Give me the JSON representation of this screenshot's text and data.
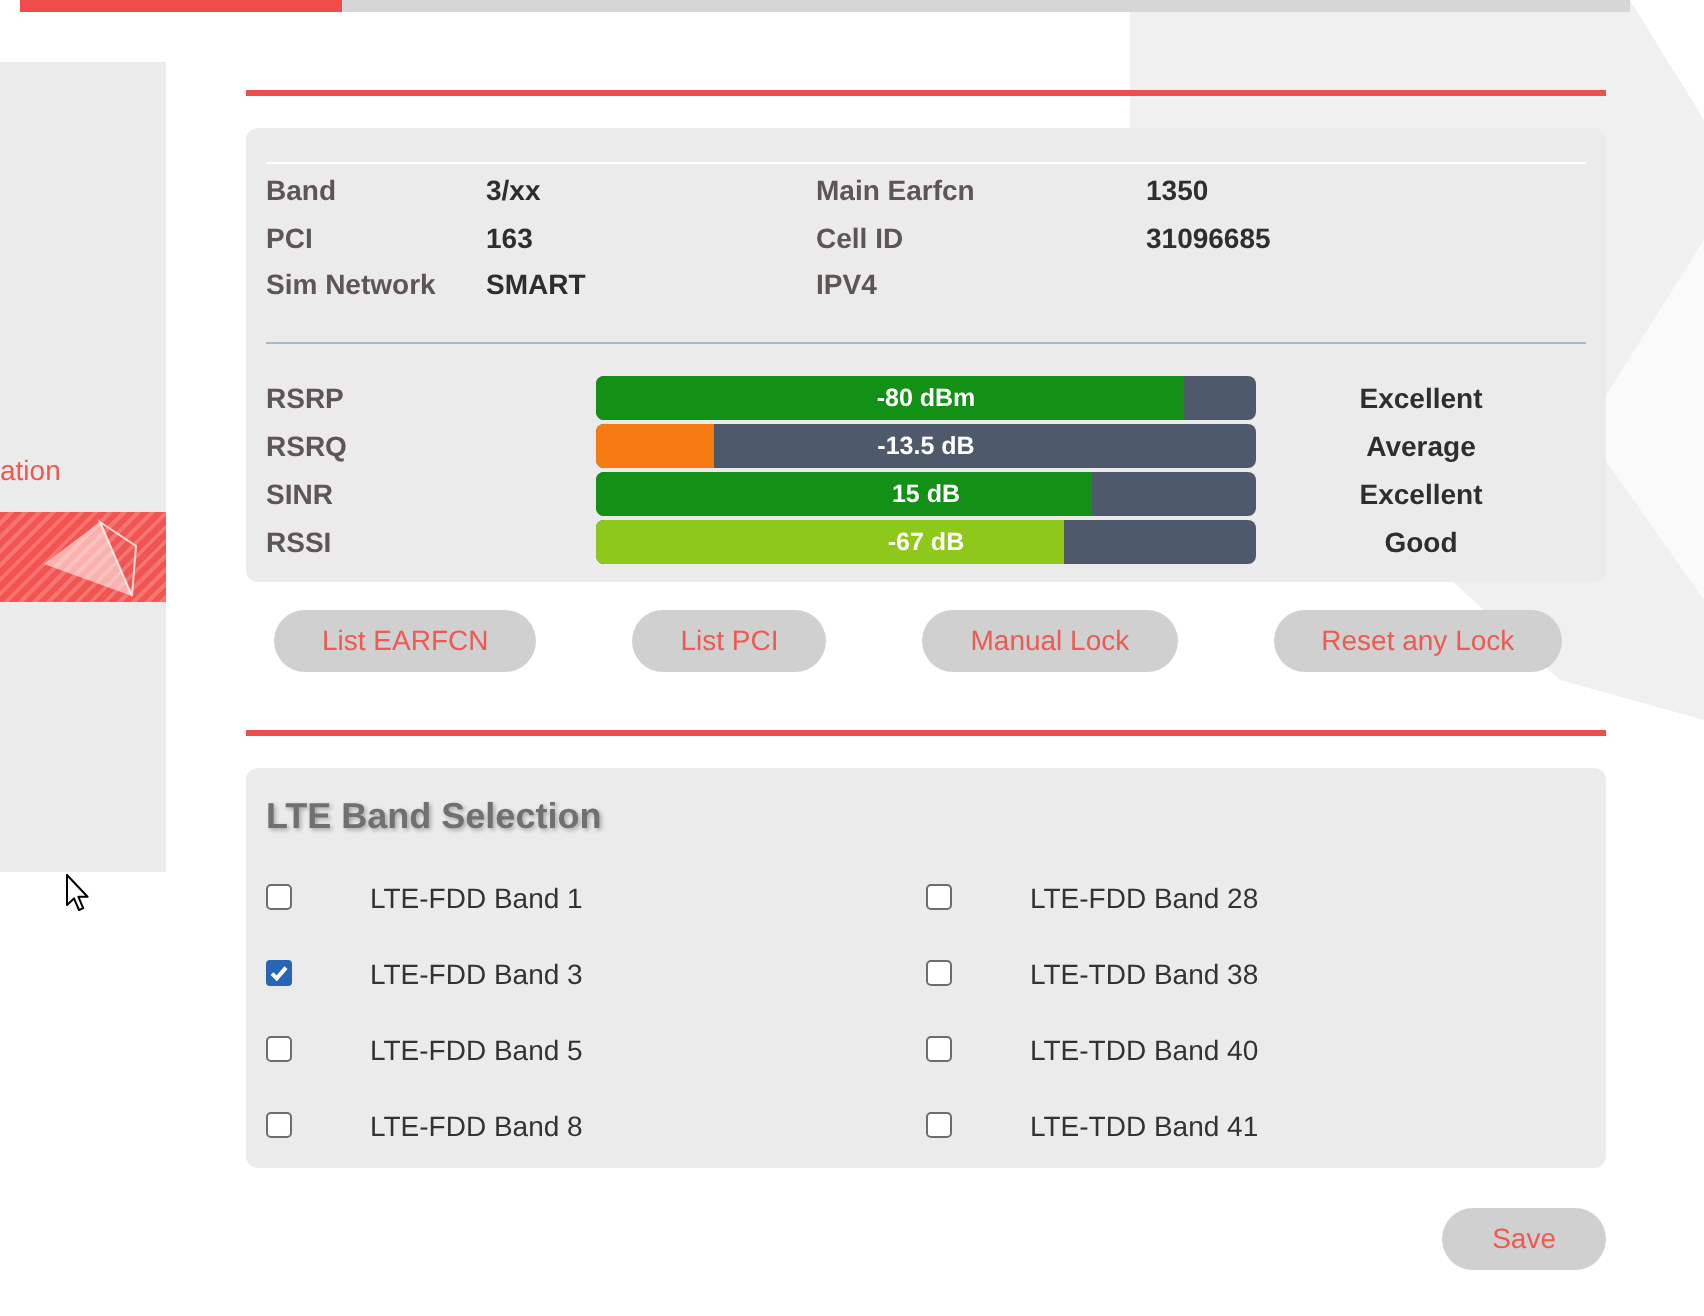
{
  "progress_bar": {
    "level": 0.2
  },
  "sidebar": {
    "items": [
      {
        "kind": "text",
        "label": "ation",
        "selected": false
      },
      {
        "kind": "icon",
        "selected": true
      }
    ]
  },
  "cell_info": {
    "fields": [
      {
        "label": "Band",
        "value": "3/xx"
      },
      {
        "label": "Main Earfcn",
        "value": "1350"
      },
      {
        "label": "PCI",
        "value": "163"
      },
      {
        "label": "Cell ID",
        "value": "31096685"
      },
      {
        "label": "Sim Network",
        "value": "SMART"
      },
      {
        "label": "IPV4"
      }
    ]
  },
  "signals": [
    {
      "name": "RSRP",
      "reading": "-80 dBm",
      "level": 0.89,
      "color": "#139117",
      "quality": "Excellent"
    },
    {
      "name": "RSRQ",
      "reading": "-13.5 dB",
      "level": 0.18,
      "color": "#f57b12",
      "quality": "Average"
    },
    {
      "name": "SINR",
      "reading": "15 dB",
      "level": 0.75,
      "color": "#139117",
      "quality": "Excellent"
    },
    {
      "name": "RSSI",
      "reading": "-67 dB",
      "level": 0.71,
      "color": "#8dc81a",
      "quality": "Good"
    }
  ],
  "actions": [
    {
      "label": "List EARFCN"
    },
    {
      "label": "List PCI"
    },
    {
      "label": "Manual Lock"
    },
    {
      "label": "Reset any Lock"
    }
  ],
  "band_selection": {
    "title": "LTE Band Selection",
    "bands": [
      {
        "label": "LTE-FDD Band 1",
        "checked": false
      },
      {
        "label": "LTE-FDD Band 28",
        "checked": false
      },
      {
        "label": "LTE-FDD Band 3",
        "checked": true
      },
      {
        "label": "LTE-TDD Band 38",
        "checked": false
      },
      {
        "label": "LTE-FDD Band 5",
        "checked": false
      },
      {
        "label": "LTE-TDD Band 40",
        "checked": false
      },
      {
        "label": "LTE-FDD Band 8",
        "checked": false
      },
      {
        "label": "LTE-TDD Band 41",
        "checked": false
      }
    ]
  },
  "save": {
    "label": "Save"
  }
}
